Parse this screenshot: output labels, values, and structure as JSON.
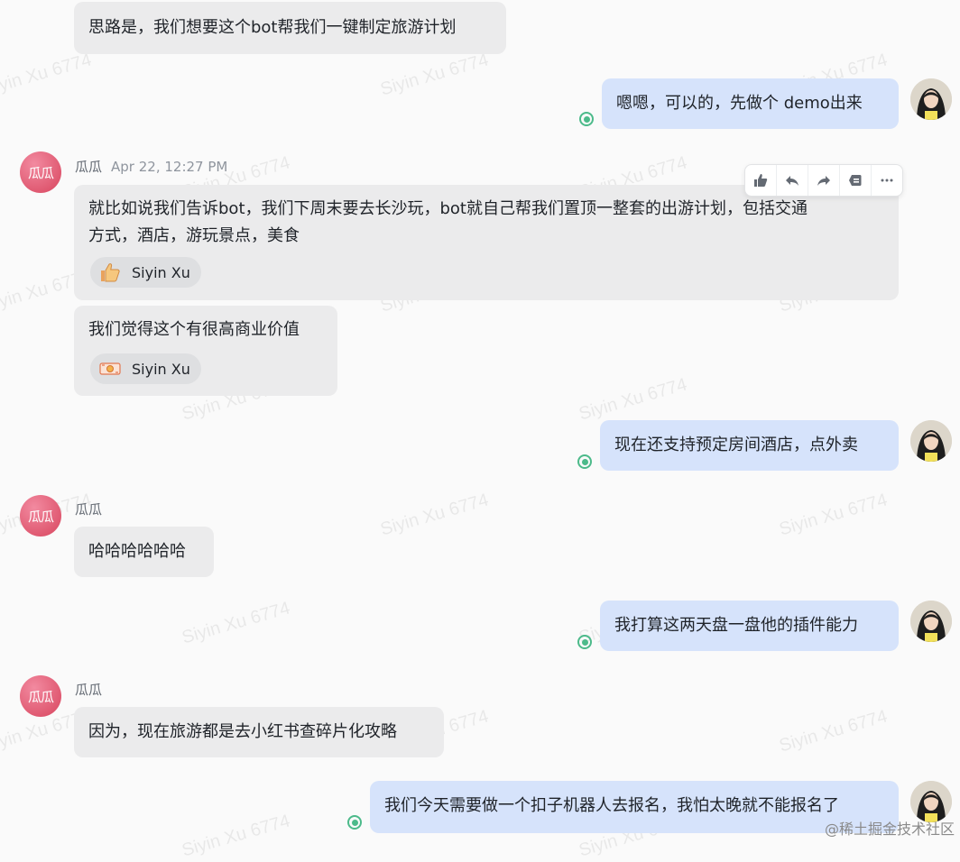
{
  "watermark": "Siyin Xu 6774",
  "corner_mark": "@稀土掘金技术社区",
  "guagua": {
    "name": "瓜瓜",
    "avatar_text": "瓜瓜"
  },
  "messages": {
    "m1": {
      "text": "思路是，我们想要这个bot帮我们一键制定旅游计划"
    },
    "m2": {
      "text": "嗯嗯，可以的，先做个 demo出来"
    },
    "m3": {
      "sender": "瓜瓜",
      "time": "Apr 22, 12:27 PM",
      "line1": "就比如说我们告诉bot，我们下周末要去长沙玩，bot就自己帮我们置顶一整套的出游计划，包括交通",
      "line2": "方式，酒店，游玩景点，美食",
      "reaction": {
        "emoji_name": "thumbs-up",
        "user": "Siyin Xu"
      }
    },
    "m4": {
      "text": "我们觉得这个有很高商业价值",
      "reaction": {
        "emoji_name": "money",
        "user": "Siyin Xu"
      }
    },
    "m5": {
      "text": "现在还支持预定房间酒店，点外卖"
    },
    "m6": {
      "sender": "瓜瓜",
      "text": "哈哈哈哈哈哈"
    },
    "m7": {
      "text": "我打算这两天盘一盘他的插件能力"
    },
    "m8": {
      "sender": "瓜瓜",
      "text": "因为，现在旅游都是去小红书查碎片化攻略"
    },
    "m9": {
      "text": "我们今天需要做一个扣子机器人去报名，我怕太晚就不能报名了"
    }
  },
  "toolbar": {
    "icons": [
      "thumbs-up-icon",
      "reply-icon",
      "forward-icon",
      "pin-icon",
      "more-icon"
    ]
  }
}
